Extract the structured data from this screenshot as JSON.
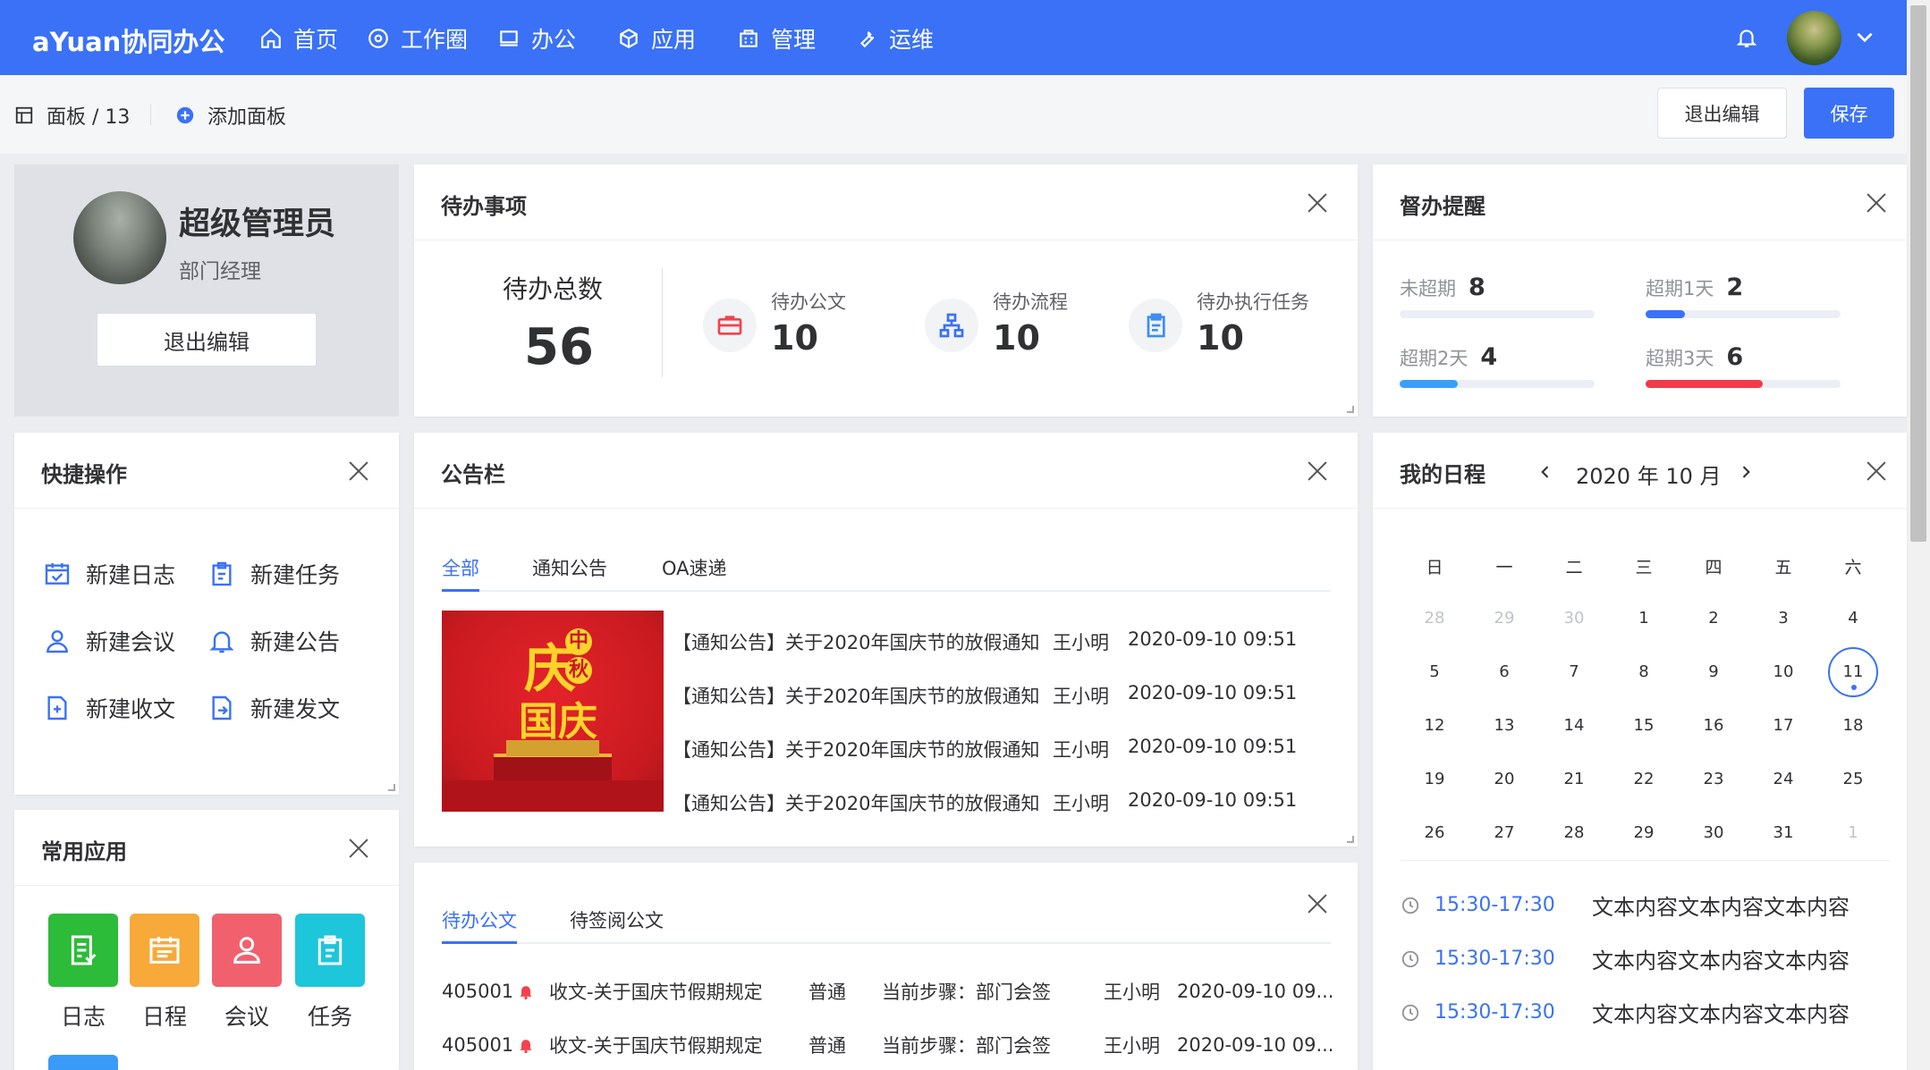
{
  "topbar": {
    "logo": "aYuan协同办公",
    "nav": [
      {
        "label": "首页",
        "icon": "home-icon"
      },
      {
        "label": "工作圈",
        "icon": "compass-icon"
      },
      {
        "label": "办公",
        "icon": "monitor-icon"
      },
      {
        "label": "应用",
        "icon": "cube-icon"
      },
      {
        "label": "管理",
        "icon": "building-icon"
      },
      {
        "label": "运维",
        "icon": "wrench-icon"
      }
    ]
  },
  "subbar": {
    "breadcrumb": "面板 / 13",
    "add_panel": "添加面板",
    "exit_edit": "退出编辑",
    "save": "保存"
  },
  "profile": {
    "name": "超级管理员",
    "role": "部门经理",
    "exit_edit": "退出编辑"
  },
  "todo": {
    "title": "待办事项",
    "total_label": "待办总数",
    "total_value": "56",
    "items": [
      {
        "label": "待办公文",
        "value": "10",
        "icon": "briefcase-icon",
        "color": "#f2424d"
      },
      {
        "label": "待办流程",
        "value": "10",
        "icon": "flow-tree-icon",
        "color": "#3a71f7"
      },
      {
        "label": "待办执行任务",
        "value": "10",
        "icon": "clipboard-icon",
        "color": "#3a8ef7"
      }
    ]
  },
  "supervise": {
    "title": "督办提醒",
    "items": [
      {
        "label": "未超期",
        "value": "8",
        "fraction": 0,
        "color": "#3a71f7"
      },
      {
        "label": "超期1天",
        "value": "2",
        "fraction": 0.2,
        "color": "#3a71f7"
      },
      {
        "label": "超期2天",
        "value": "4",
        "fraction": 0.3,
        "color": "#3aa0f7"
      },
      {
        "label": "超期3天",
        "value": "6",
        "fraction": 0.6,
        "color": "#f23a4a"
      }
    ]
  },
  "quick": {
    "title": "快捷操作",
    "items": [
      {
        "label": "新建日志",
        "icon": "calendar-check-icon"
      },
      {
        "label": "新建任务",
        "icon": "clipboard-icon"
      },
      {
        "label": "新建会议",
        "icon": "user-icon"
      },
      {
        "label": "新建公告",
        "icon": "bell-icon"
      },
      {
        "label": "新建收文",
        "icon": "doc-in-icon"
      },
      {
        "label": "新建发文",
        "icon": "doc-out-icon"
      }
    ]
  },
  "notice": {
    "title": "公告栏",
    "tabs": [
      "全部",
      "通知公告",
      "OA速递"
    ],
    "banner_text": [
      "庆",
      "中",
      "秋",
      "国庆"
    ],
    "rows": [
      {
        "title": "【通知公告】关于2020年国庆节的放假通知",
        "author": "王小明",
        "time": "2020-09-10 09:51"
      },
      {
        "title": "【通知公告】关于2020年国庆节的放假通知",
        "author": "王小明",
        "time": "2020-09-10 09:51"
      },
      {
        "title": "【通知公告】关于2020年国庆节的放假通知",
        "author": "王小明",
        "time": "2020-09-10 09:51"
      },
      {
        "title": "【通知公告】关于2020年国庆节的放假通知",
        "author": "王小明",
        "time": "2020-09-10 09:51"
      }
    ]
  },
  "schedule": {
    "title": "我的日程",
    "month": "2020 年 10 月",
    "weekdays": [
      "日",
      "一",
      "二",
      "三",
      "四",
      "五",
      "六"
    ],
    "days": [
      [
        "28",
        "29",
        "30",
        "1",
        "2",
        "3",
        "4"
      ],
      [
        "5",
        "6",
        "7",
        "8",
        "9",
        "10",
        "11"
      ],
      [
        "12",
        "13",
        "14",
        "15",
        "16",
        "17",
        "18"
      ],
      [
        "19",
        "20",
        "21",
        "22",
        "23",
        "24",
        "25"
      ],
      [
        "26",
        "27",
        "28",
        "29",
        "30",
        "31",
        "1"
      ]
    ],
    "events": [
      {
        "time": "15:30-17:30",
        "text": "文本内容文本内容文本内容"
      },
      {
        "time": "15:30-17:30",
        "text": "文本内容文本内容文本内容"
      },
      {
        "time": "15:30-17:30",
        "text": "文本内容文本内容文本内容"
      }
    ]
  },
  "apps": {
    "title": "常用应用",
    "items": [
      {
        "label": "日志",
        "color": "#2dbb3a",
        "icon": "log-icon"
      },
      {
        "label": "日程",
        "color": "#f7a93a",
        "icon": "calendar-icon"
      },
      {
        "label": "会议",
        "color": "#f0616d",
        "icon": "user-icon"
      },
      {
        "label": "任务",
        "color": "#1ec6db",
        "icon": "clipboard-icon"
      }
    ]
  },
  "docs": {
    "tabs": [
      "待办公文",
      "待签阅公文"
    ],
    "rows": [
      {
        "id": "405001",
        "title": "收文-关于国庆节假期规定",
        "level": "普通",
        "step": "当前步骤：部门会签",
        "user": "王小明",
        "time": "2020-09-10 09..."
      },
      {
        "id": "405001",
        "title": "收文-关于国庆节假期规定",
        "level": "普通",
        "step": "当前步骤：部门会签",
        "user": "王小明",
        "time": "2020-09-10 09..."
      }
    ]
  }
}
